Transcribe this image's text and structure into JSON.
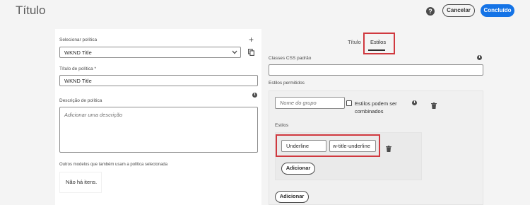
{
  "header": {
    "title": "Título",
    "help_glyph": "?",
    "cancel_label": "Cancelar",
    "done_label": "Concluído"
  },
  "policy": {
    "select_label": "Selecionar política",
    "selected_value": "WKND Title",
    "title_label": "Título de política *",
    "title_value": "WKND Title",
    "description_label": "Descrição de política",
    "description_placeholder": "Adicionar uma descrição",
    "other_models_label": "Outros modelos que também usam a política selecionada",
    "no_items_text": "Não há itens."
  },
  "tabs": {
    "items": [
      {
        "label": "Título",
        "active": false
      },
      {
        "label": "Estilos",
        "active": true
      }
    ]
  },
  "styles": {
    "css_classes_label": "Classes CSS padrão",
    "allowed_styles_label": "Estilos permitidos",
    "group_name_placeholder": "Nome do grupo",
    "combinable_label_line1": "Estilos podem ser",
    "combinable_label_line2": "combinados",
    "styles_label": "Estilos",
    "style_name_value": "Underline",
    "style_class_value": "w-title-underline",
    "add_style_label": "Adicionar",
    "add_group_label": "Adicionar"
  },
  "icons": {
    "plus": "plus-icon",
    "copy": "copy-icon",
    "info": "info-icon",
    "trash": "trash-icon",
    "chevron": "chevron-down-icon",
    "help": "help-icon"
  },
  "colors": {
    "accent": "#1473e6",
    "highlight": "#d0393f"
  }
}
